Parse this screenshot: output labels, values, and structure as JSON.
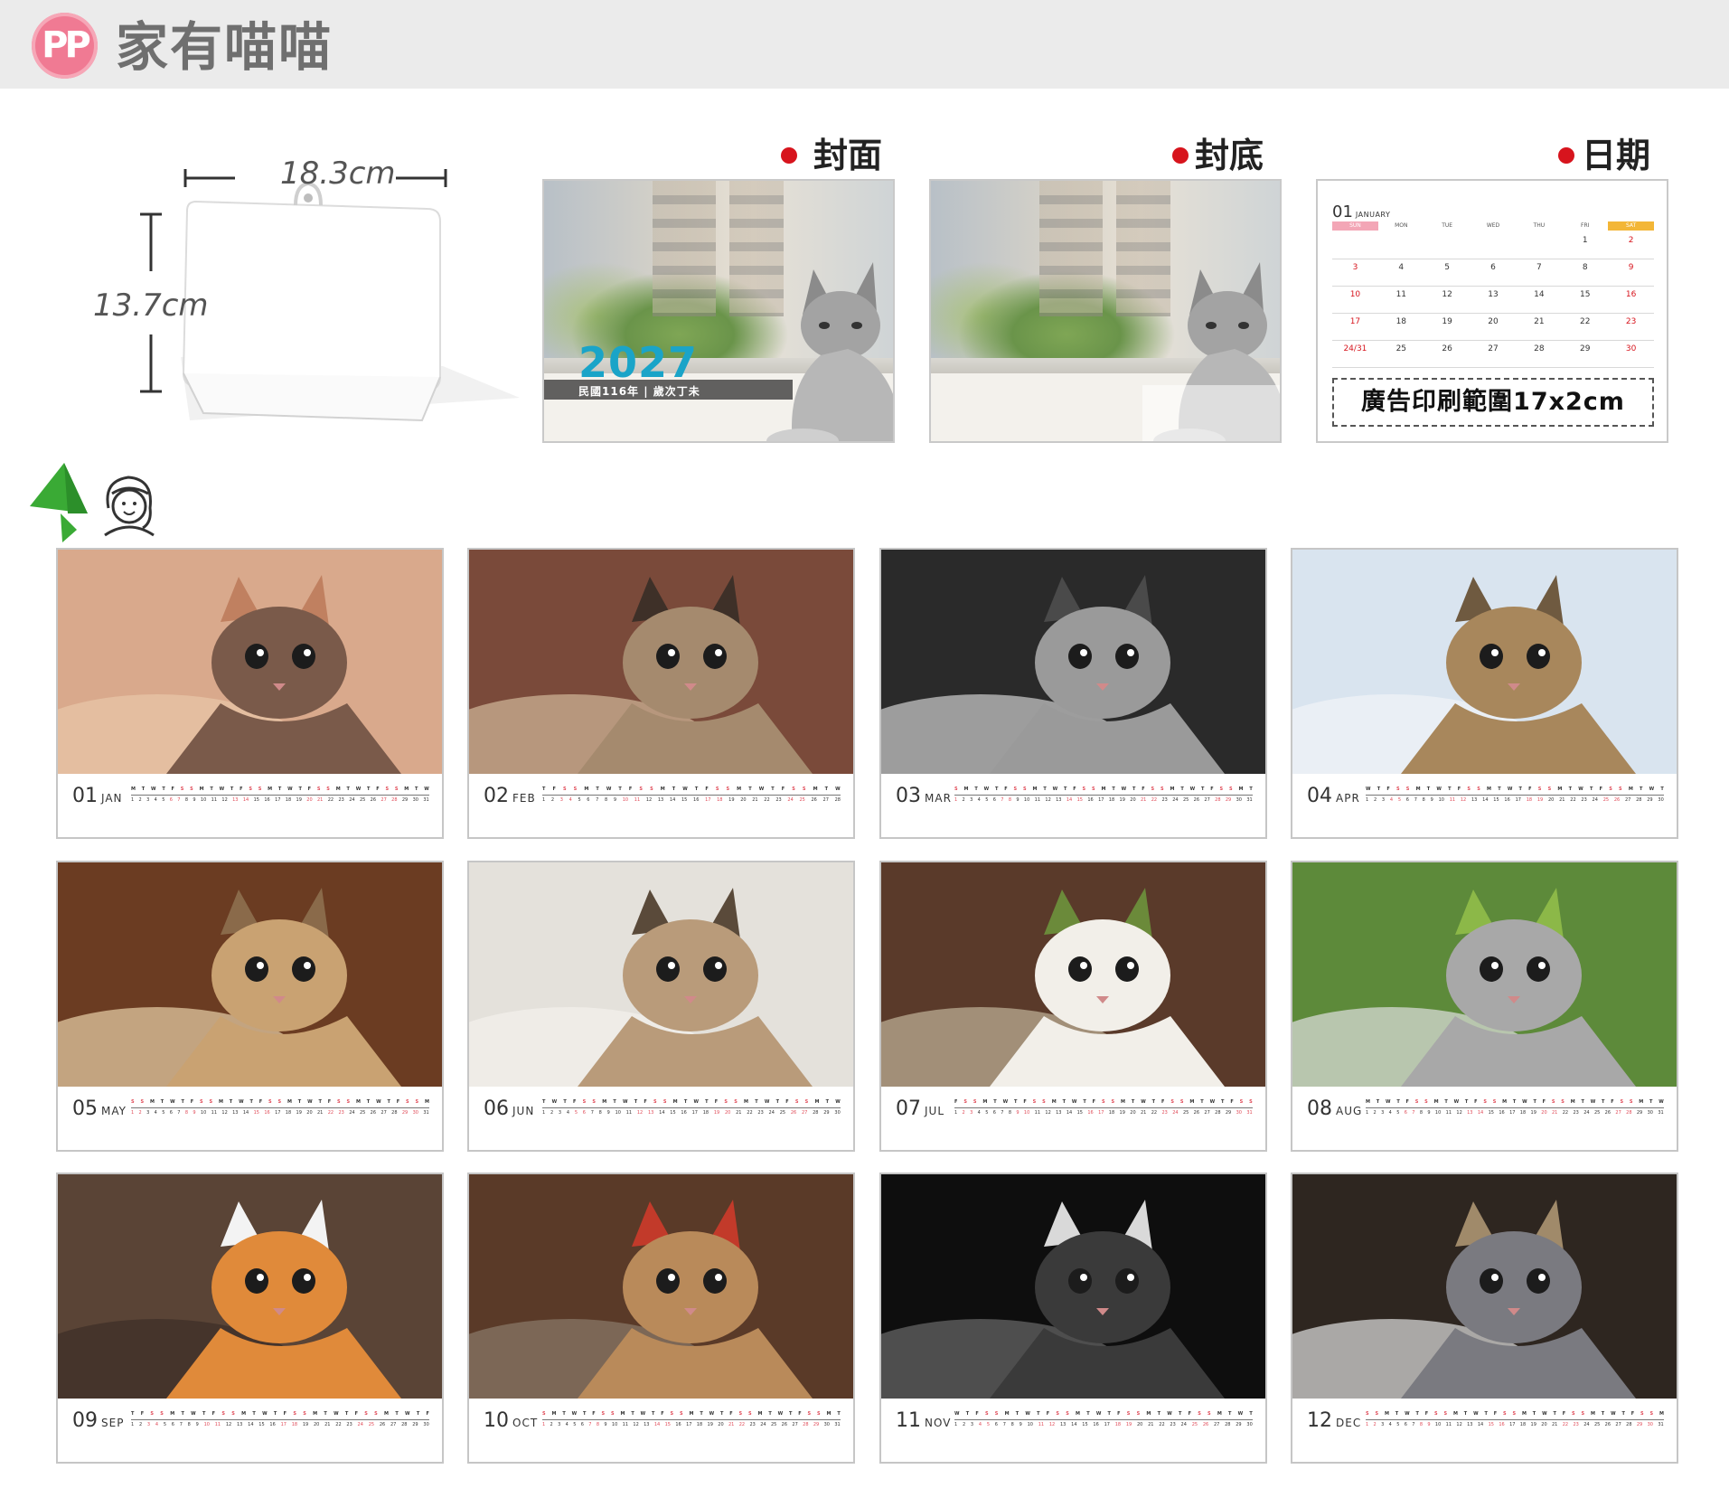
{
  "header": {
    "logo_text": "PP",
    "brand": "家有喵喵"
  },
  "dimensions": {
    "width_label": "18.3cm",
    "height_label": "13.7cm"
  },
  "labels": {
    "cover": "封面",
    "back": "封底",
    "date": "日期"
  },
  "cover": {
    "year": "2027",
    "subtitle": "民國116年 | 歲次丁未"
  },
  "date_panel": {
    "month_number": "01",
    "month_name": "JANUARY",
    "weekday_headers": [
      "SUN",
      "MON",
      "TUE",
      "WED",
      "THU",
      "FRI",
      "SAT"
    ],
    "weeks": [
      [
        "",
        "",
        "",
        "",
        "",
        "1",
        "2"
      ],
      [
        "3",
        "4",
        "5",
        "6",
        "7",
        "8",
        "9"
      ],
      [
        "10",
        "11",
        "12",
        "13",
        "14",
        "15",
        "16"
      ],
      [
        "17",
        "18",
        "19",
        "20",
        "21",
        "22",
        "23"
      ],
      [
        "24/31",
        "25",
        "26",
        "27",
        "28",
        "29",
        "30"
      ]
    ],
    "ad_text": "廣告印刷範圍17x2cm"
  },
  "months": [
    {
      "num": "01",
      "abbr": "JAN",
      "days": 31
    },
    {
      "num": "02",
      "abbr": "FEB",
      "days": 28
    },
    {
      "num": "03",
      "abbr": "MAR",
      "days": 31
    },
    {
      "num": "04",
      "abbr": "APR",
      "days": 30
    },
    {
      "num": "05",
      "abbr": "MAY",
      "days": 31
    },
    {
      "num": "06",
      "abbr": "JUN",
      "days": 30
    },
    {
      "num": "07",
      "abbr": "JUL",
      "days": 31
    },
    {
      "num": "08",
      "abbr": "AUG",
      "days": 31
    },
    {
      "num": "09",
      "abbr": "SEP",
      "days": 30
    },
    {
      "num": "10",
      "abbr": "OCT",
      "days": 31
    },
    {
      "num": "11",
      "abbr": "NOV",
      "days": 30
    },
    {
      "num": "12",
      "abbr": "DEC",
      "days": 31
    }
  ],
  "colors": {
    "header_bg": "#ebebeb",
    "logo": "#f07a93",
    "accent_red": "#d7141d",
    "year_blue": "#1aa4c8",
    "weekend_red": "#e04b58"
  }
}
